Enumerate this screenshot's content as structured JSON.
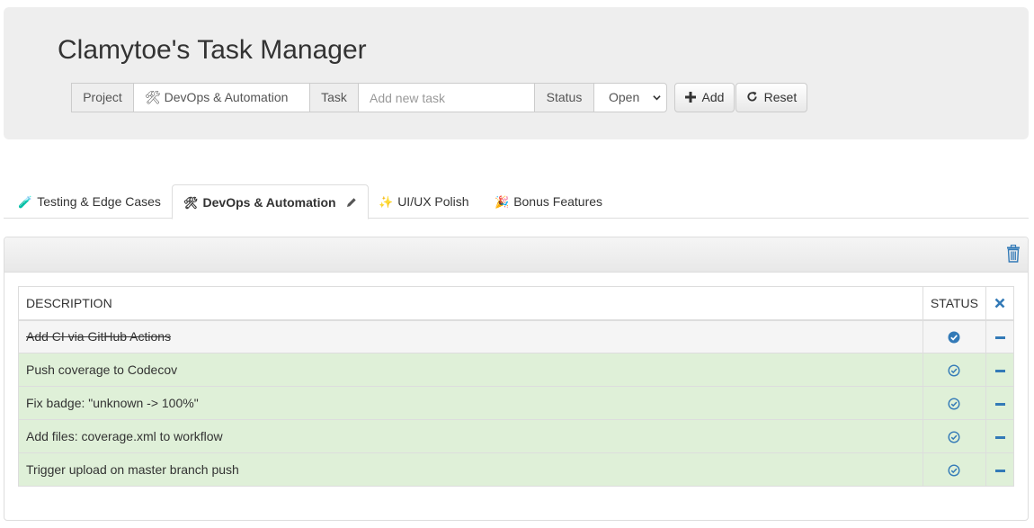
{
  "header": {
    "title": "Clamytoe's Task Manager"
  },
  "form": {
    "project_label": "Project",
    "project_value": "🛠 DevOps & Automation",
    "task_label": "Task",
    "task_placeholder": "Add new task",
    "task_value": "",
    "status_label": "Status",
    "status_value": "Open",
    "add_label": "Add",
    "reset_label": "Reset"
  },
  "tabs": [
    {
      "icon": "🧪",
      "label": "Testing & Edge Cases",
      "active": false
    },
    {
      "icon": "🛠",
      "label": "DevOps & Automation",
      "active": true
    },
    {
      "icon": "✨",
      "label": "UI/UX Polish",
      "active": false
    },
    {
      "icon": "🎉",
      "label": "Bonus Features",
      "active": false
    }
  ],
  "table": {
    "headers": {
      "description": "DESCRIPTION",
      "status": "STATUS"
    },
    "rows": [
      {
        "description": "Add CI via GitHub Actions",
        "state": "done"
      },
      {
        "description": "Push coverage to Codecov",
        "state": "open"
      },
      {
        "description": "Fix badge: \"unknown -> 100%\"",
        "state": "open"
      },
      {
        "description": "Add files: coverage.xml to workflow",
        "state": "open"
      },
      {
        "description": "Trigger upload on master branch push",
        "state": "open"
      }
    ]
  },
  "icons": {
    "tab_edit": "pencil-icon",
    "delete_project": "trash-icon",
    "clear_done": "x-icon",
    "row_status": "check-circle-icon",
    "row_delete": "minus-icon"
  },
  "colors": {
    "accent": "#337ab7",
    "open_row": "#dff0d8",
    "done_row": "#f5f5f5",
    "jumbotron": "#eeeeee"
  }
}
